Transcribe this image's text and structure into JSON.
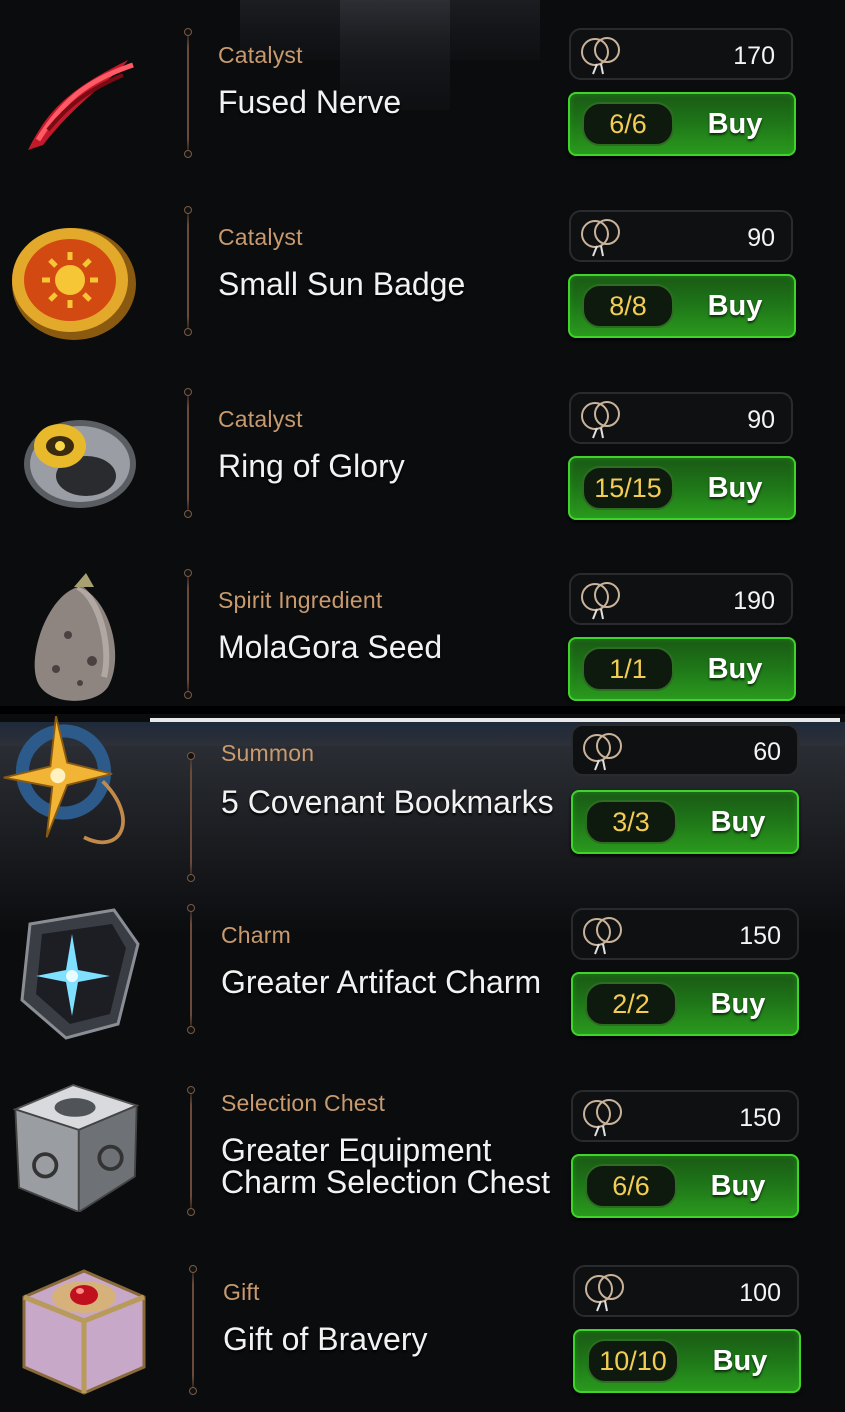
{
  "items": [
    {
      "category": "Catalyst",
      "name": "Fused Nerve",
      "price": "170",
      "limit": "6/6",
      "buy": "Buy",
      "icon": "fused-nerve-icon"
    },
    {
      "category": "Catalyst",
      "name": "Small Sun Badge",
      "price": "90",
      "limit": "8/8",
      "buy": "Buy",
      "icon": "sun-badge-icon"
    },
    {
      "category": "Catalyst",
      "name": "Ring of Glory",
      "price": "90",
      "limit": "15/15",
      "buy": "Buy",
      "icon": "ring-icon"
    },
    {
      "category": "Spirit Ingredient",
      "name": "MolaGora Seed",
      "price": "190",
      "limit": "1/1",
      "buy": "Buy",
      "icon": "seed-icon"
    },
    {
      "category": "Summon",
      "name": "5 Covenant Bookmarks",
      "price": "60",
      "limit": "3/3",
      "buy": "Buy",
      "icon": "covenant-bookmark-icon"
    },
    {
      "category": "Charm",
      "name": "Greater Artifact Charm",
      "price": "150",
      "limit": "2/2",
      "buy": "Buy",
      "icon": "artifact-charm-icon"
    },
    {
      "category": "Selection Chest",
      "name_line1": "Greater Equipment",
      "name_line2": "Charm Selection Chest",
      "price": "150",
      "limit": "6/6",
      "buy": "Buy",
      "icon": "selection-chest-icon"
    },
    {
      "category": "Gift",
      "name": "Gift of Bravery",
      "price": "100",
      "limit": "10/10",
      "buy": "Buy",
      "icon": "gift-box-icon"
    }
  ],
  "currency_icon": "friendship-bookmark-icon",
  "colors": {
    "category": "#c89a6e",
    "limit_text": "#f3cc55",
    "buy_green": "#2a9a1e"
  }
}
